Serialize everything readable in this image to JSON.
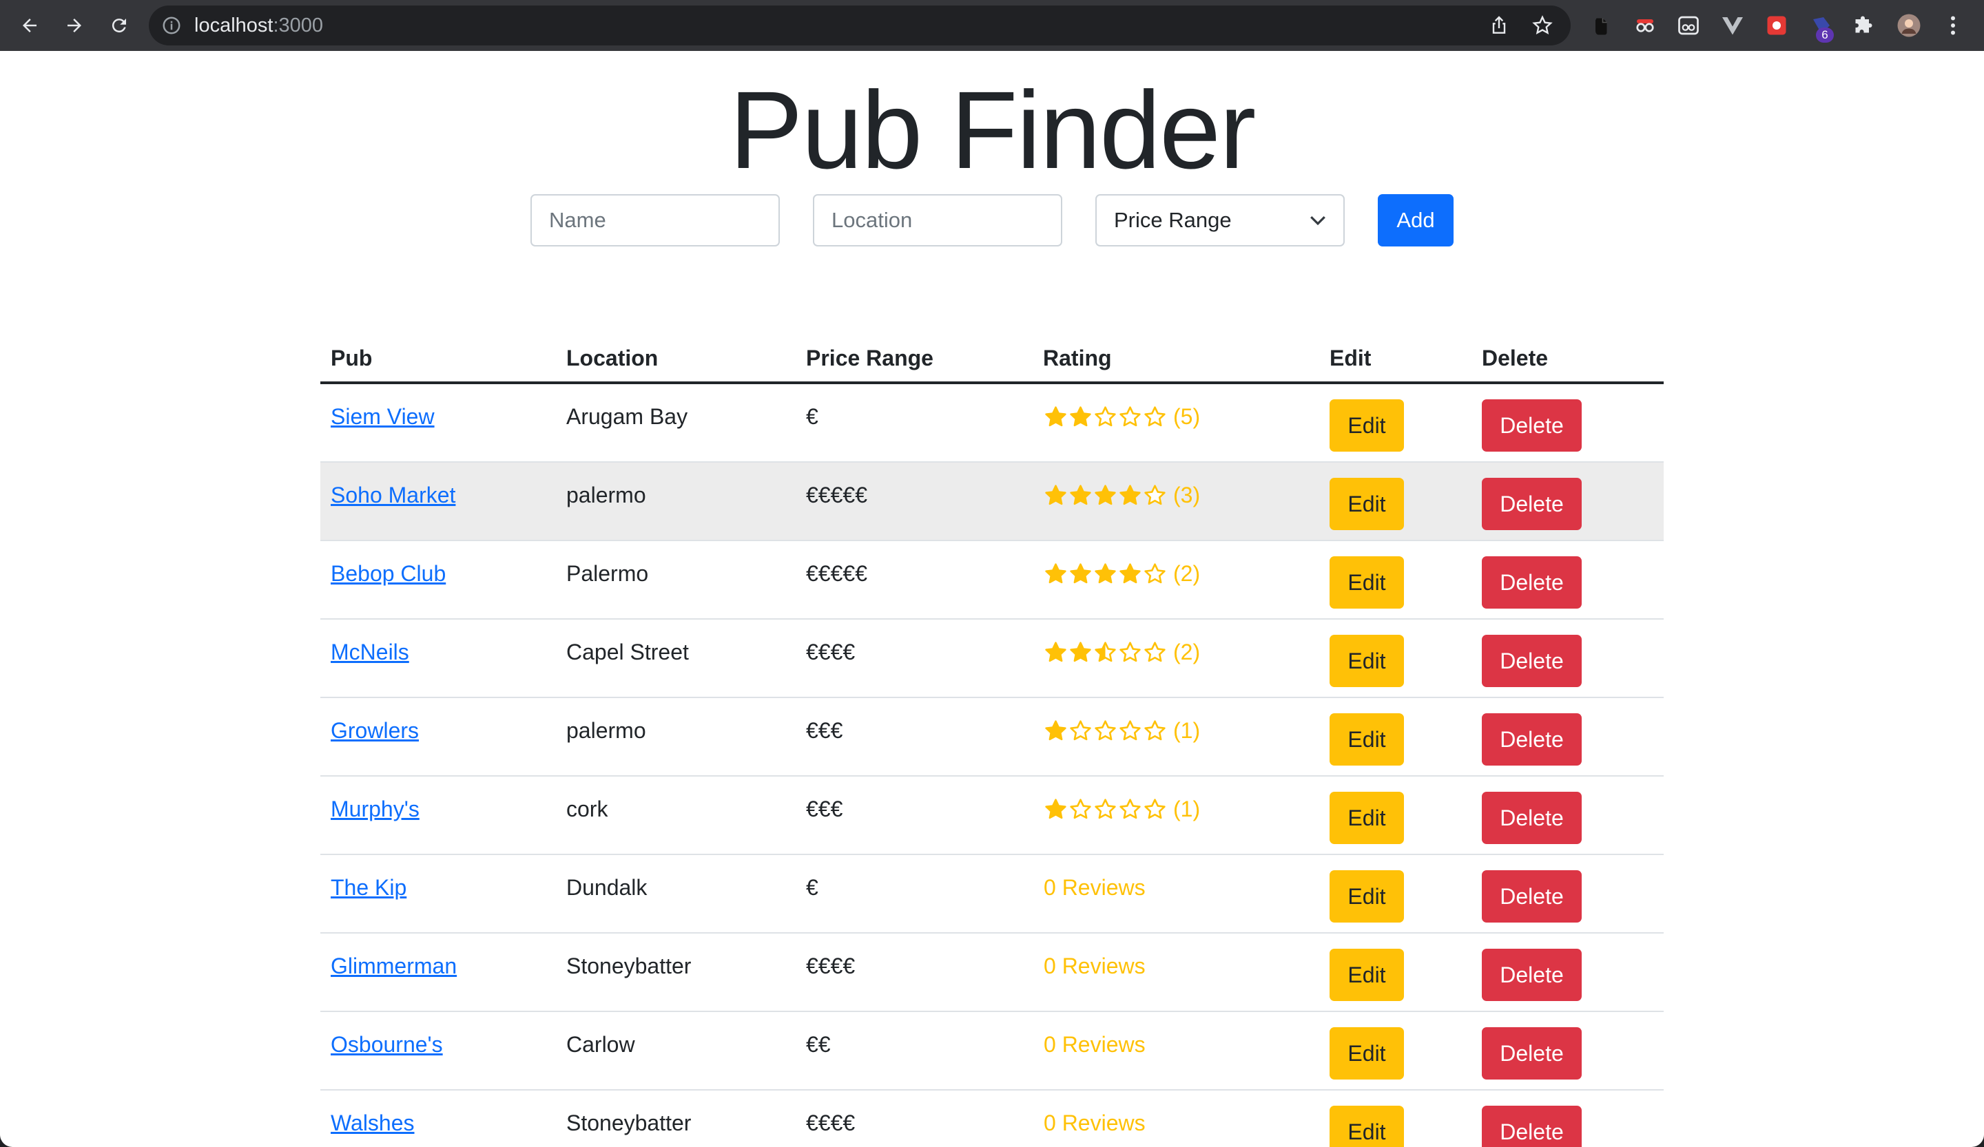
{
  "browser": {
    "url_host": "localhost",
    "url_port": ":3000",
    "extension_badge": "6"
  },
  "app": {
    "title": "Pub Finder"
  },
  "form": {
    "name_placeholder": "Name",
    "location_placeholder": "Location",
    "price_select_value": "Price Range",
    "add_label": "Add"
  },
  "table": {
    "headers": [
      "Pub",
      "Location",
      "Price Range",
      "Rating",
      "Edit",
      "Delete"
    ],
    "rows": [
      {
        "pub": "Siem View",
        "location": "Arugam Bay",
        "price": "€",
        "rating": 2,
        "count": "(5)",
        "reviews_text": ""
      },
      {
        "pub": "Soho Market",
        "location": "palermo",
        "price": "€€€€€",
        "rating": 4,
        "count": "(3)",
        "reviews_text": ""
      },
      {
        "pub": "Bebop Club",
        "location": "Palermo",
        "price": "€€€€€",
        "rating": 4,
        "count": "(2)",
        "reviews_text": ""
      },
      {
        "pub": "McNeils",
        "location": "Capel Street",
        "price": "€€€€",
        "rating": 2.5,
        "count": "(2)",
        "reviews_text": ""
      },
      {
        "pub": "Growlers",
        "location": "palermo",
        "price": "€€€",
        "rating": 1,
        "count": "(1)",
        "reviews_text": ""
      },
      {
        "pub": "Murphy's",
        "location": "cork",
        "price": "€€€",
        "rating": 1,
        "count": "(1)",
        "reviews_text": ""
      },
      {
        "pub": "The Kip",
        "location": "Dundalk",
        "price": "€",
        "rating": 0,
        "count": "",
        "reviews_text": "0 Reviews"
      },
      {
        "pub": "Glimmerman",
        "location": "Stoneybatter",
        "price": "€€€€",
        "rating": 0,
        "count": "",
        "reviews_text": "0 Reviews"
      },
      {
        "pub": "Osbourne's",
        "location": "Carlow",
        "price": "€€",
        "rating": 0,
        "count": "",
        "reviews_text": "0 Reviews"
      },
      {
        "pub": "Walshes",
        "location": "Stoneybatter",
        "price": "€€€€",
        "rating": 0,
        "count": "",
        "reviews_text": "0 Reviews"
      }
    ],
    "edit_label": "Edit",
    "delete_label": "Delete"
  },
  "colors": {
    "primary": "#0d6efd",
    "warning": "#ffc107",
    "danger": "#dc3545"
  }
}
